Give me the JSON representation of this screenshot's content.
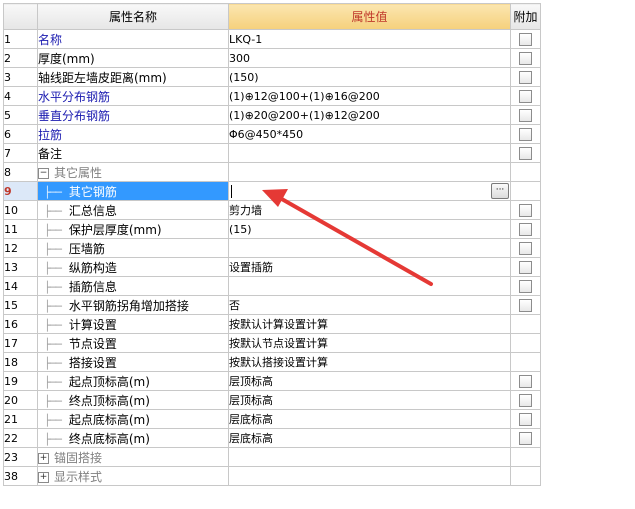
{
  "header": {
    "num": "",
    "name": "属性名称",
    "value": "属性值",
    "extra": "附加"
  },
  "rows": [
    {
      "num": "1",
      "name": "名称",
      "value": "LKQ-1",
      "blue": true,
      "checkbox": true
    },
    {
      "num": "2",
      "name": "厚度(mm)",
      "value": "300",
      "blue": false,
      "checkbox": true
    },
    {
      "num": "3",
      "name": "轴线距左墙皮距离(mm)",
      "value": "(150)",
      "blue": false,
      "checkbox": true
    },
    {
      "num": "4",
      "name": "水平分布钢筋",
      "value": "(1)⊕12@100+(1)⊕16@200",
      "blue": true,
      "checkbox": true
    },
    {
      "num": "5",
      "name": "垂直分布钢筋",
      "value": "(1)⊕20@200+(1)⊕12@200",
      "blue": true,
      "checkbox": true
    },
    {
      "num": "6",
      "name": "拉筋",
      "value": "Φ6@450*450",
      "blue": true,
      "checkbox": true
    },
    {
      "num": "7",
      "name": "备注",
      "value": "",
      "blue": false,
      "checkbox": true
    },
    {
      "num": "8",
      "name": "其它属性",
      "expander": "−",
      "group": true
    },
    {
      "num": "9",
      "name": "其它钢筋",
      "child": true,
      "selected": true,
      "editing": true
    },
    {
      "num": "10",
      "name": "汇总信息",
      "value": "剪力墙",
      "child": true,
      "checkbox": true
    },
    {
      "num": "11",
      "name": "保护层厚度(mm)",
      "value": "(15)",
      "child": true,
      "checkbox": true
    },
    {
      "num": "12",
      "name": "压墙筋",
      "value": "",
      "child": true,
      "checkbox": true
    },
    {
      "num": "13",
      "name": "纵筋构造",
      "value": "设置插筋",
      "child": true,
      "checkbox": true
    },
    {
      "num": "14",
      "name": "插筋信息",
      "value": "",
      "child": true,
      "checkbox": true
    },
    {
      "num": "15",
      "name": "水平钢筋拐角增加搭接",
      "value": "否",
      "child": true,
      "checkbox": true
    },
    {
      "num": "16",
      "name": "计算设置",
      "value": "按默认计算设置计算",
      "child": true,
      "checkbox": false
    },
    {
      "num": "17",
      "name": "节点设置",
      "value": "按默认节点设置计算",
      "child": true,
      "checkbox": false
    },
    {
      "num": "18",
      "name": "搭接设置",
      "value": "按默认搭接设置计算",
      "child": true,
      "checkbox": false
    },
    {
      "num": "19",
      "name": "起点顶标高(m)",
      "value": "层顶标高",
      "child": true,
      "checkbox": true
    },
    {
      "num": "20",
      "name": "终点顶标高(m)",
      "value": "层顶标高",
      "child": true,
      "checkbox": true
    },
    {
      "num": "21",
      "name": "起点底标高(m)",
      "value": "层底标高",
      "child": true,
      "checkbox": true
    },
    {
      "num": "22",
      "name": "终点底标高(m)",
      "value": "层底标高",
      "child": true,
      "checkbox": true
    },
    {
      "num": "23",
      "name": "锚固搭接",
      "expander": "+",
      "group": true
    },
    {
      "num": "38",
      "name": "显示样式",
      "expander": "+",
      "group": true
    }
  ],
  "ellipsis_label": "···",
  "tree_connector": "├──",
  "colors": {
    "accent_header": "#f5d07c",
    "selection": "#3399ff",
    "arrow": "#e53935",
    "link_text": "#1a1ab0"
  }
}
